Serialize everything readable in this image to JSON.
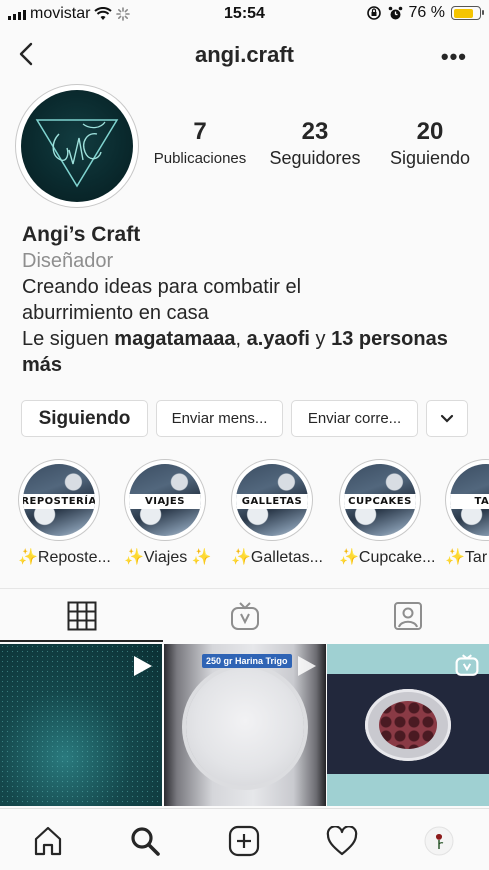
{
  "status_bar": {
    "carrier": "movistar",
    "time": "15:54",
    "battery_percent": "76 %",
    "battery_level": 0.76,
    "battery_color": "#f5c400"
  },
  "nav": {
    "title": "angi.craft",
    "back_icon": "chevron-left-icon",
    "more_icon": "more-horizontal-icon",
    "more_label": "•••"
  },
  "profile": {
    "stats": [
      {
        "value": "7",
        "label": "Publicaciones"
      },
      {
        "value": "23",
        "label": "Seguidores"
      },
      {
        "value": "20",
        "label": "Siguiendo"
      }
    ],
    "name": "Angi’s Craft",
    "category": "Diseñador",
    "bio_line1": "Creando ideas para combatir el",
    "bio_line2": "aburrimiento en casa",
    "followed_prefix": "Le siguen ",
    "followed_user1": "magatamaaa",
    "followed_sep": ", ",
    "followed_user2": "a.yaofi",
    "followed_and": " y ",
    "followed_rest": "13 personas más"
  },
  "actions": {
    "following_label": "Siguiendo",
    "message_label": "Enviar mens...",
    "email_label": "Enviar corre...",
    "dropdown_icon": "chevron-down-icon"
  },
  "highlights": [
    {
      "tag": "REPOSTERÍA",
      "caption": "✨Reposte..."
    },
    {
      "tag": "VIAJES",
      "caption": "✨Viajes ✨"
    },
    {
      "tag": "GALLETAS",
      "caption": "✨Galletas..."
    },
    {
      "tag": "CUPCAKES",
      "caption": "✨Cupcake..."
    },
    {
      "tag": "TAR",
      "caption": "✨Tar"
    }
  ],
  "tabs": [
    {
      "icon": "grid-icon"
    },
    {
      "icon": "igtv-icon"
    },
    {
      "icon": "tagged-person-icon"
    }
  ],
  "posts": [
    {
      "kind": "video"
    },
    {
      "kind": "video",
      "overlay_text": "250 gr Harina Trigo"
    },
    {
      "kind": "igtv"
    }
  ],
  "bottom_nav": [
    {
      "icon": "home-icon"
    },
    {
      "icon": "search-icon"
    },
    {
      "icon": "add-post-icon"
    },
    {
      "icon": "heart-icon"
    },
    {
      "icon": "profile-avatar-icon"
    }
  ]
}
